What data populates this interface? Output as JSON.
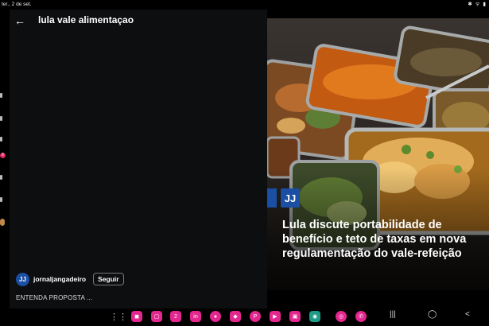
{
  "status_bar": {
    "left_text": "ter., 2 de set.",
    "right_text": "✱ ᯤ ▮"
  },
  "search": {
    "query": "lula vale alimentaçao"
  },
  "post": {
    "username": "jornaljangadeiro",
    "follow_label": "Seguir",
    "caption": "ENTENDA PROPOSTA ...",
    "avatar_text": "JJ",
    "logo_text": "JJ",
    "headline_lines": [
      "Lula discute portabilidade de",
      "benefício e teto de taxas em nova",
      "regulamentação do vale-refeição"
    ]
  },
  "left_badge": "6",
  "taskbar": {
    "apps": [
      "grid-icon",
      "app-pink-icon",
      "app-pink-icon",
      "calendar-icon",
      "linkedin-icon",
      "app-pink-icon",
      "app-pink-icon",
      "pinterest-icon",
      "youtube-icon",
      "app-pink-icon",
      "app-teal-icon",
      "chrome-icon",
      "whatsapp-icon"
    ],
    "calendar_label": "2"
  },
  "colors": {
    "brand_blue": "#1a4fa3",
    "taskbar_pink": "#e4268f",
    "panel_bg": "#0d0e10"
  }
}
